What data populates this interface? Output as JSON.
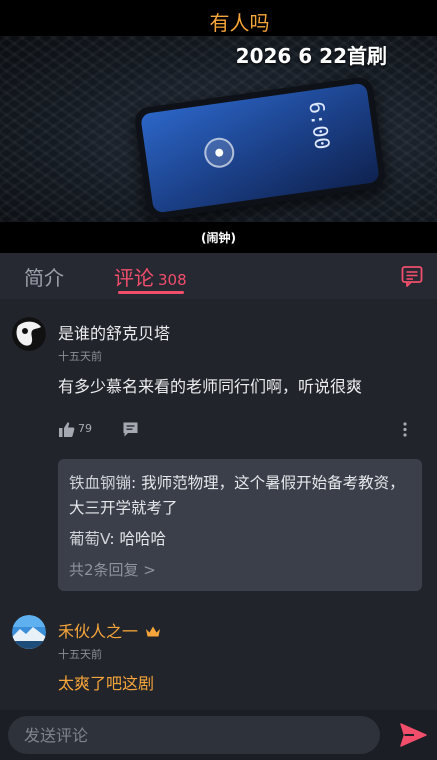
{
  "video": {
    "overlay_title": "有人吗",
    "overlay_subtitle": "2026 6 22首刷",
    "phone_time": "6:00",
    "caption": "(闹钟)"
  },
  "tabs": {
    "intro_label": "简介",
    "comments_label": "评论",
    "comments_count": "308",
    "active": "comments"
  },
  "comments": [
    {
      "username": "是谁的舒克贝塔",
      "time": "十五天前",
      "text": "有多少慕名来看的老师同行们啊，听说很爽",
      "likes": "79",
      "replies": [
        {
          "user": "铁血钢镚",
          "text": "我师范物理，这个暑假开始备考教资，大三开学就考了"
        },
        {
          "user": "葡萄V",
          "text": "哈哈哈"
        }
      ],
      "more_replies": "共2条回复 >"
    },
    {
      "username": "禾伙人之一",
      "badge": "crown-icon",
      "time": "十五天前",
      "text": "太爽了吧这剧"
    }
  ],
  "bottom_bar": {
    "input_placeholder": "发送评论"
  },
  "colors": {
    "accent": "#f14e6c",
    "gold": "#f6a53a",
    "background": "#21242b",
    "reply_box": "#3a3f4a"
  }
}
